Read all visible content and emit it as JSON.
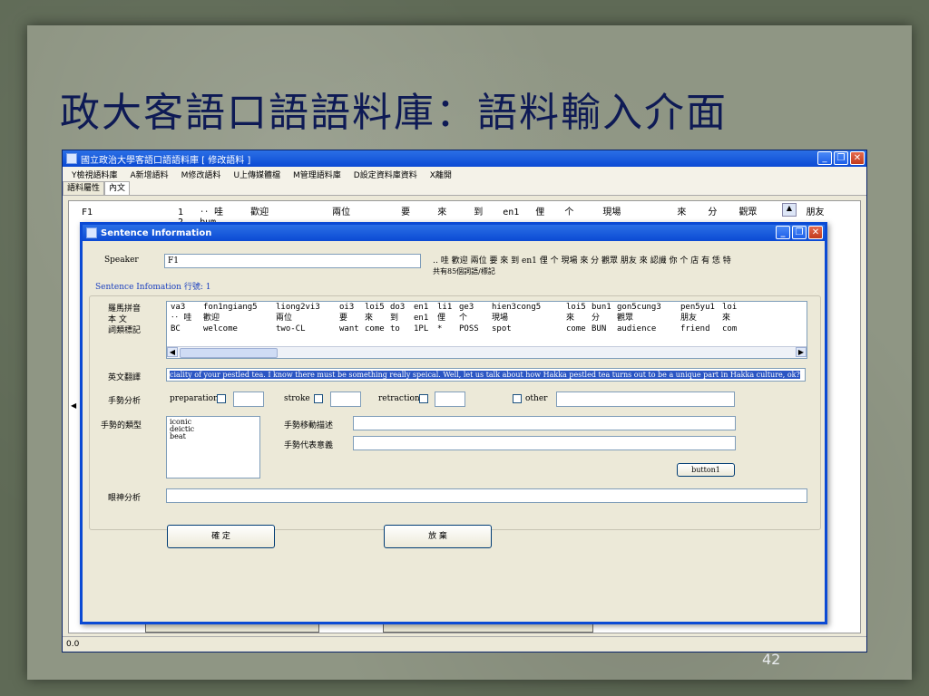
{
  "slide": {
    "title": "政大客語口語語料庫：語料輸入介面",
    "page_number": "42"
  },
  "main_window": {
    "title": "國立政治大學客語口語語料庫 [ 修改語料 ]",
    "menu": [
      "Y檢視語料庫",
      "A新增語料",
      "M修改語料",
      "U上傳媒體檔",
      "M管理語料庫",
      "D設定資料庫資料",
      "X離開"
    ],
    "tabs": [
      "語料屬性",
      "內文"
    ],
    "bg_row": {
      "speaker": "F1",
      "index1": "1",
      "index2": "2",
      "words": [
        "‥ 哇",
        "歡迎",
        "兩位",
        "要",
        "來",
        "到",
        "en1",
        "俚",
        "个",
        "現場",
        "來",
        "分",
        "觀眾",
        "朋友"
      ],
      "partial": "bum"
    },
    "status": "0.0"
  },
  "dialog": {
    "title": "Sentence Information",
    "speaker_label": "Speaker",
    "speaker_value": "F1",
    "sentence_text": "‥ 哇 歡迎 兩位 要 來 到 en1 俚 个 現場 來 分 觀眾 朋友 來 認識 你 个 店 有 恁 特",
    "word_count": "共有85個詞語/標記",
    "group_title": "Sentence Infomation  行號: 1",
    "row_labels": [
      "羅馬拼音",
      "本 文",
      "詞類標記"
    ],
    "grid": {
      "romanization": [
        "va3",
        "fon1ngiang5",
        "liong2vi3",
        "oi3",
        "loi5",
        "do3",
        "en1",
        "li1",
        "ge3",
        "hien3cong5",
        "loi5",
        "bun1",
        "gon5cung3",
        "pen5yu1",
        "loi"
      ],
      "text": [
        "‥ 哇",
        "歡迎",
        "兩位",
        "要",
        "來",
        "到",
        "en1",
        "俚",
        "个",
        "現場",
        "來",
        "分",
        "觀眾",
        "朋友",
        "來"
      ],
      "pos": [
        "BC",
        "welcome",
        "two-CL",
        "want",
        "come",
        "to",
        "1PL",
        "*",
        "POSS",
        "spot",
        "come",
        "BUN",
        "audience",
        "friend",
        "com"
      ]
    },
    "translation_label": "英文翻譯",
    "translation_value": "ciality  of your pestled tea.  I know there must be something really speical.  Well, let us talk about how Hakka pestled tea turns out to be a unique part in Hakka  culture, ok?",
    "gesture_label": "手勢分析",
    "gesture_opts": [
      "preparation",
      "stroke",
      "retraction",
      "other"
    ],
    "gesture_type_label": "手勢的類型",
    "gesture_types": [
      "iconic",
      "deictic",
      "beat"
    ],
    "gesture_move_label": "手勢移動描述",
    "gesture_meaning_label": "手勢代表意義",
    "button1": "button1",
    "gaze_label": "眼神分析",
    "confirm": "確 定",
    "cancel": "放 棄"
  }
}
